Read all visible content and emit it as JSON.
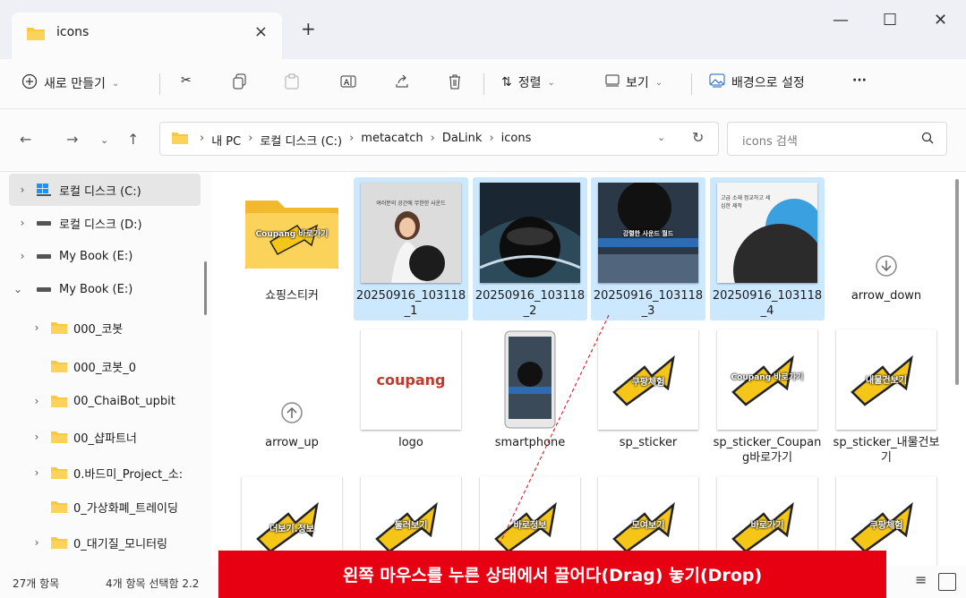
{
  "window": {
    "tab_title": "icons",
    "tab_close": "×",
    "new_tab": "+",
    "minimize": "—",
    "maximize": "☐",
    "close": "✕"
  },
  "toolbar": {
    "new_label": "새로 만들기",
    "sort_label": "정렬",
    "view_label": "보기",
    "set_background_label": "배경으로 설정",
    "more_label": "···"
  },
  "address": {
    "breadcrumbs": [
      "내 PC",
      "로컬 디스크 (C:)",
      "metacatch",
      "DaLink",
      "icons"
    ],
    "separator": "›",
    "search_placeholder": "icons 검색"
  },
  "sidebar": {
    "items": [
      {
        "label": "로컬 디스크 (C:)",
        "icon": "drive-windows-icon"
      },
      {
        "label": "로컬 디스크 (D:)",
        "icon": "drive-icon"
      },
      {
        "label": "My Book (E:)",
        "icon": "drive-icon"
      },
      {
        "label": "My Book (E:)",
        "icon": "drive-icon"
      },
      {
        "label": "000_코봇",
        "icon": "folder-icon"
      },
      {
        "label": "000_코봇_0",
        "icon": "folder-icon"
      },
      {
        "label": "00_ChaiBot_upbit",
        "icon": "folder-icon"
      },
      {
        "label": "00_샵파트너",
        "icon": "folder-icon"
      },
      {
        "label": "0.바드미_Project_소:",
        "icon": "folder-icon"
      },
      {
        "label": "0_가상화폐_트레이딩",
        "icon": "folder-icon"
      },
      {
        "label": "0_대기질_모니터링",
        "icon": "folder-icon"
      }
    ]
  },
  "files": [
    {
      "name": "쇼핑스티커",
      "selected": false,
      "kind": "folder",
      "thumb_text": "Coupang 바로가기"
    },
    {
      "name": "20250916_103118_1",
      "selected": true,
      "kind": "photo1",
      "thumb_text": "여러분의 공간에 무한한 사운드"
    },
    {
      "name": "20250916_103118_2",
      "selected": true,
      "kind": "photo2",
      "thumb_text": ""
    },
    {
      "name": "20250916_103118_3",
      "selected": true,
      "kind": "photo3",
      "thumb_text": "강렬한 사운드 월드"
    },
    {
      "name": "20250916_103118_4",
      "selected": true,
      "kind": "photo4",
      "thumb_text": "고급 소재 정교하고 세심한 제작"
    },
    {
      "name": "arrow_down",
      "selected": false,
      "kind": "arrow-down",
      "thumb_text": ""
    },
    {
      "name": "arrow_up",
      "selected": false,
      "kind": "arrow-up",
      "thumb_text": ""
    },
    {
      "name": "logo",
      "selected": false,
      "kind": "logo",
      "thumb_text": "coupang"
    },
    {
      "name": "smartphone",
      "selected": false,
      "kind": "phone",
      "thumb_text": ""
    },
    {
      "name": "sp_sticker",
      "selected": false,
      "kind": "sticker",
      "thumb_text": "쿠팡체험"
    },
    {
      "name": "sp_sticker_Coupang바로가기",
      "selected": false,
      "kind": "sticker",
      "thumb_text": "Coupang 바로가기"
    },
    {
      "name": "sp_sticker_내물건보기",
      "selected": false,
      "kind": "sticker",
      "thumb_text": "내물건보기"
    },
    {
      "name": "",
      "selected": false,
      "kind": "sticker",
      "thumb_text": "더보기.정보"
    },
    {
      "name": "",
      "selected": false,
      "kind": "sticker",
      "thumb_text": "둘러보기"
    },
    {
      "name": "",
      "selected": false,
      "kind": "sticker",
      "thumb_text": "바로정보"
    },
    {
      "name": "",
      "selected": false,
      "kind": "sticker",
      "thumb_text": "모여보기"
    },
    {
      "name": "",
      "selected": false,
      "kind": "sticker",
      "thumb_text": "바로가기"
    },
    {
      "name": "",
      "selected": false,
      "kind": "sticker",
      "thumb_text": "쿠팡체험"
    }
  ],
  "status": {
    "item_count": "27개 항목",
    "selected_count": "4개 항목 선택함 2.2"
  },
  "overlay": {
    "banner_text": "왼쪽 마우스를 누른 상태에서 끌어다(Drag) 놓기(Drop)"
  },
  "colors": {
    "selection": "#cce8ff",
    "banner": "#e60012",
    "sticker_yellow": "#f5c518",
    "folder": "#f8c843"
  }
}
